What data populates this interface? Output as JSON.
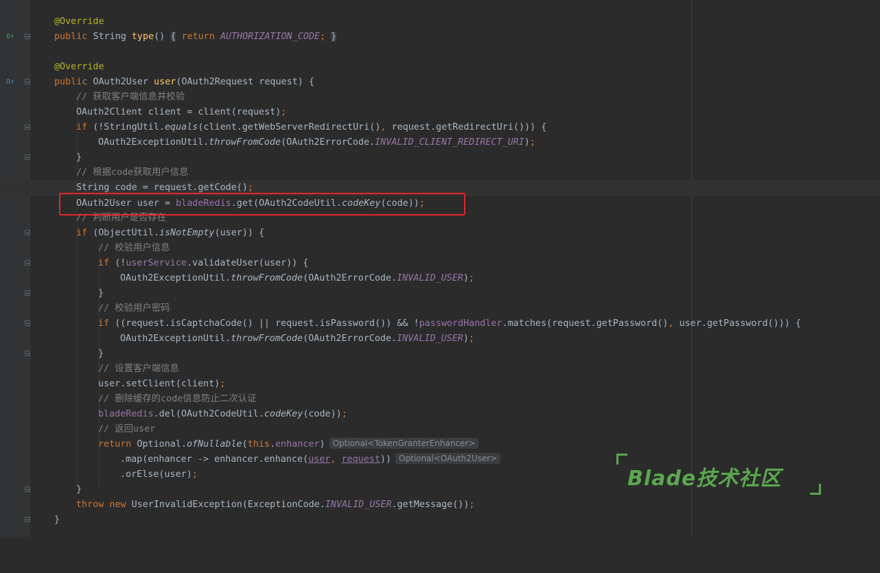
{
  "editor": {
    "language": "Java",
    "gutter_icons": {
      "override_type": "O↑",
      "override_user": "O↑"
    },
    "lines": {
      "l01": {
        "text": "@Override"
      },
      "l02": {
        "kw": "public",
        "type": "String",
        "fn": "type",
        "parens": "()",
        "fold_open": "{",
        "kw2": "return",
        "const": "AUTHORIZATION_CODE",
        "semi": ";",
        "fold_close": "}"
      },
      "l04": {
        "text": "@Override"
      },
      "l05": {
        "kw": "public",
        "a": "OAuth2User",
        "fn": "user",
        "b": "(OAuth2Request request) {"
      },
      "l06": {
        "text": "// 获取客户端信息并校验"
      },
      "l07": {
        "a": "OAuth2Client client = client(request)",
        "semi": ";"
      },
      "l08": {
        "kw": "if",
        "a": "(!StringUtil.",
        "m": "equals",
        "b": "(client.getWebServerRedirectUri()",
        "c": ",",
        "d": " request.getRedirectUri())) {"
      },
      "l09": {
        "a": "OAuth2ExceptionUtil.",
        "m": "throwFromCode",
        "b": "(OAuth2ErrorCode.",
        "const": "INVALID_CLIENT_REDIRECT_URI",
        "c": ")",
        "semi": ";"
      },
      "l10": {
        "text": "}"
      },
      "l11": {
        "text": "// 根据code获取用户信息"
      },
      "l12": {
        "a": "String code = request.getCode()",
        "semi": ";"
      },
      "l13": {
        "a": "OAuth2User user = ",
        "fld": "bladeRedis",
        "b": ".get(OAuth2CodeUtil.",
        "m": "codeKey",
        "c": "(code))",
        "semi": ";"
      },
      "l14": {
        "text": "// 判断用户是否存在"
      },
      "l15": {
        "kw": "if",
        "a": "(ObjectUtil.",
        "m": "isNotEmpty",
        "b": "(user)) {"
      },
      "l16": {
        "text": "// 校验用户信息"
      },
      "l17": {
        "kw": "if",
        "a": "(!",
        "fld": "userService",
        "b": ".validateUser(user)) {"
      },
      "l18": {
        "a": "OAuth2ExceptionUtil.",
        "m": "throwFromCode",
        "b": "(OAuth2ErrorCode.",
        "const": "INVALID_USER",
        "c": ")",
        "semi": ";"
      },
      "l19": {
        "text": "}"
      },
      "l20": {
        "text": "// 校验用户密码"
      },
      "l21": {
        "kw": "if",
        "a": "((request.isCaptchaCode() || request.isPassword()) && !",
        "fld": "passwordHandler",
        "b": ".matches(request.getPassword()",
        "c": ",",
        "d": " user.getPassword())) {"
      },
      "l22": {
        "a": "OAuth2ExceptionUtil.",
        "m": "throwFromCode",
        "b": "(OAuth2ErrorCode.",
        "const": "INVALID_USER",
        "c": ")",
        "semi": ";"
      },
      "l23": {
        "text": "}"
      },
      "l24": {
        "text": "// 设置客户端信息"
      },
      "l25": {
        "a": "user.setClient(client)",
        "semi": ";"
      },
      "l26": {
        "text": "// 删除缓存的code信息防止二次认证"
      },
      "l27": {
        "fld": "bladeRedis",
        "a": ".del(OAuth2CodeUtil.",
        "m": "codeKey",
        "b": "(code))",
        "semi": ";"
      },
      "l28": {
        "text": "// 返回user"
      },
      "l29": {
        "kw": "return",
        "a": " Optional.",
        "m": "ofNullable",
        "b": "(",
        "kw2": "this",
        "c": ".",
        "fld": "enhancer",
        "d": ")",
        "hint": "Optional<TokenGranterEnhancer>"
      },
      "l30": {
        "a": ".map(enhancer -> enhancer.enhance(",
        "u1": "user",
        "c": ",",
        "sp": " ",
        "u2": "request",
        "d": "))",
        "hint": "Optional<OAuth2User>"
      },
      "l31": {
        "a": ".orElse(user)",
        "semi": ";"
      },
      "l32": {
        "text": "}"
      },
      "l33": {
        "kw": "throw",
        "kw2": "new",
        "a": " UserInvalidException(ExceptionCode.",
        "const": "INVALID_USER",
        "b": ".getMessage())",
        "semi": ";"
      },
      "l34": {
        "text": "}"
      }
    }
  },
  "watermark": {
    "text": "Blade技术社区"
  },
  "colors": {
    "background": "#2b2b2b",
    "keyword": "#cc7832",
    "annotation": "#bbb529",
    "method": "#ffc66d",
    "comment": "#808080",
    "constant": "#9876aa",
    "plain": "#a9b7c6",
    "highlight_box": "#e5262b",
    "watermark": "#5aa74f"
  }
}
